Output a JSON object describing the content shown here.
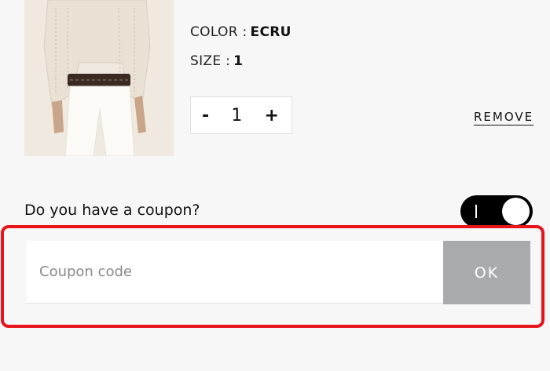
{
  "product": {
    "color_label": "COLOR :",
    "color_value": "ECRU",
    "size_label": "SIZE :",
    "size_value": "1",
    "quantity": "1",
    "minus_label": "-",
    "plus_label": "+",
    "remove_label": "REMOVE"
  },
  "coupon": {
    "question": "Do you have a coupon?",
    "toggle_on": true,
    "input_placeholder": "Coupon code",
    "input_value": "",
    "ok_label": "OK"
  },
  "colors": {
    "highlight": "#e8141c",
    "ok_button": "#a9aaad",
    "toggle": "#000000"
  }
}
